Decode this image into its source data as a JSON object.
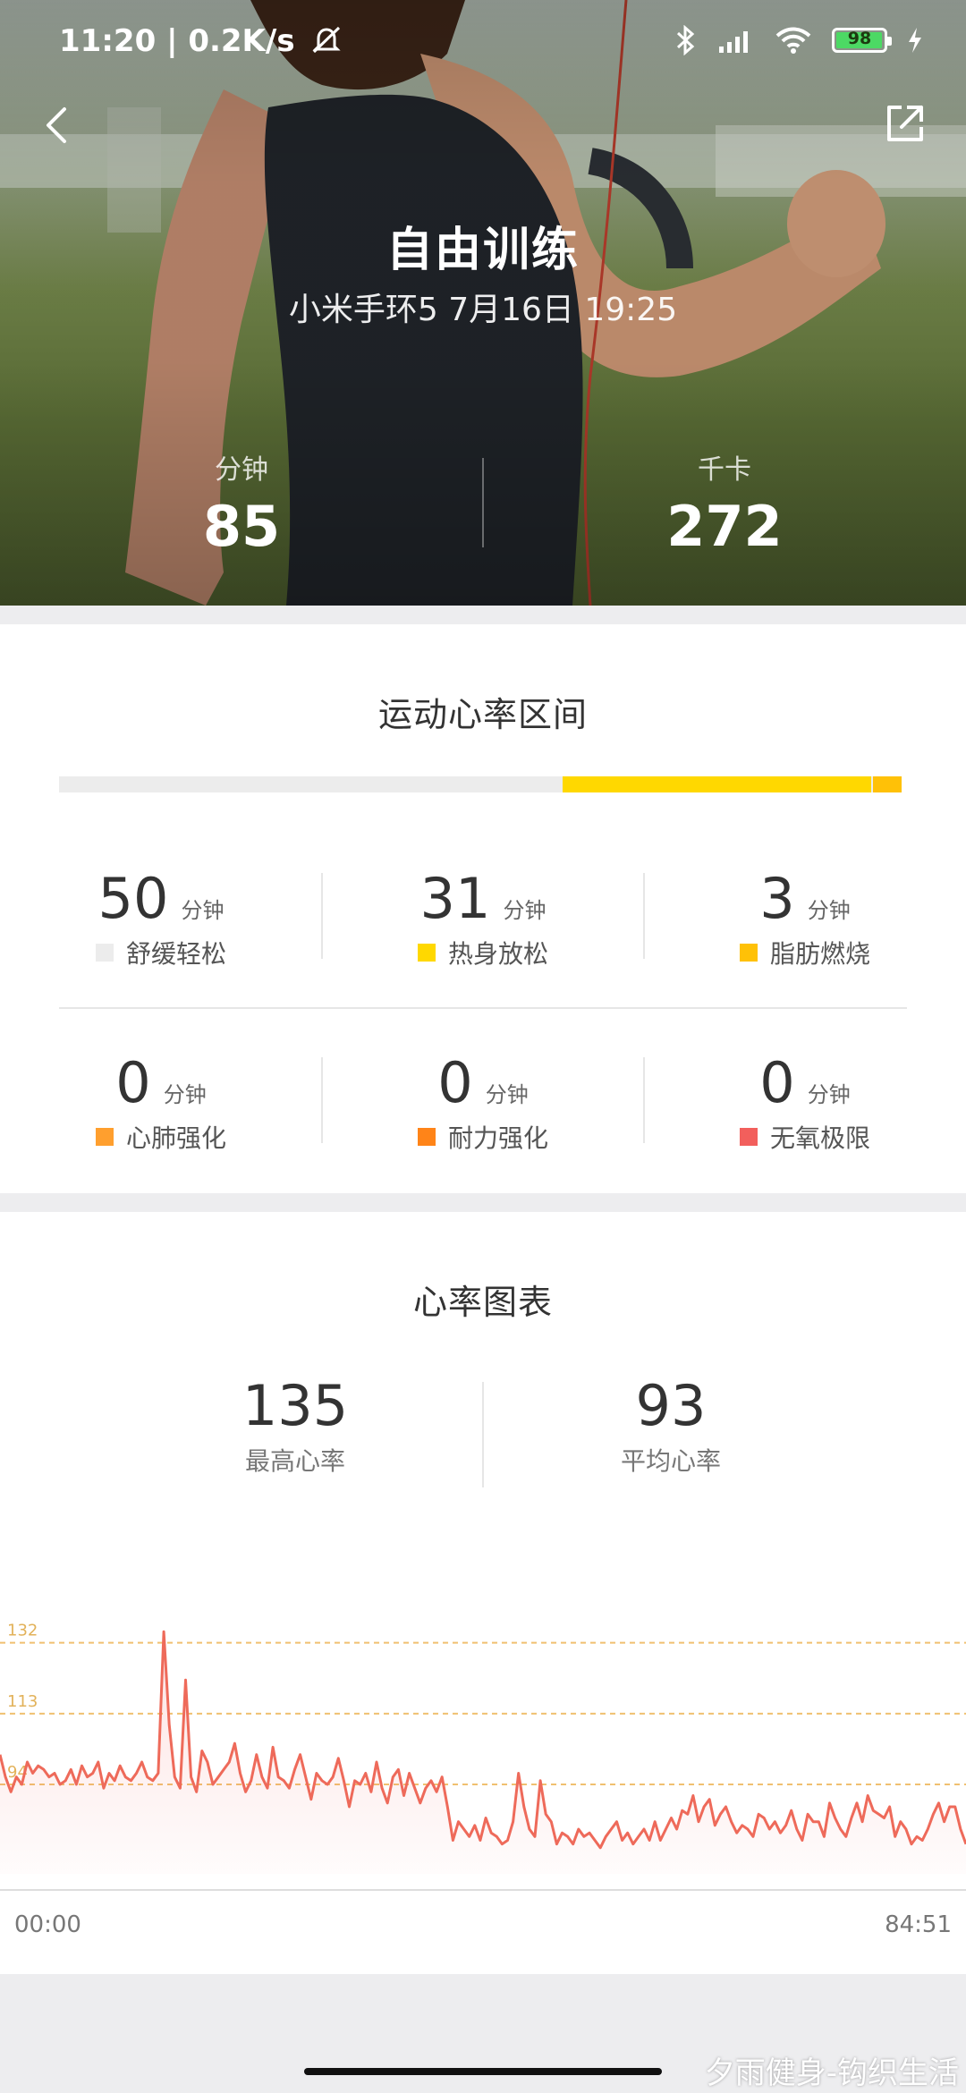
{
  "status_bar": {
    "time_speed": "11:20 | 0.2K/s",
    "battery_level": "98",
    "battery_percent": 98
  },
  "header": {
    "title": "自由训练",
    "subtitle": "小米手环5 7月16日 19:25",
    "stats": [
      {
        "label": "分钟",
        "value": "85"
      },
      {
        "label": "千卡",
        "value": "272"
      }
    ]
  },
  "zones": {
    "title": "运动心率区间",
    "bar_segments": [
      {
        "minutes": 50,
        "color": "#ececec"
      },
      {
        "minutes": 31,
        "color": "#ffd800"
      },
      {
        "minutes": 3,
        "color": "#ffc107"
      }
    ],
    "items": [
      {
        "value": "50",
        "unit": "分钟",
        "name": "舒缓轻松",
        "color": "#ececec"
      },
      {
        "value": "31",
        "unit": "分钟",
        "name": "热身放松",
        "color": "#ffd800"
      },
      {
        "value": "3",
        "unit": "分钟",
        "name": "脂肪燃烧",
        "color": "#ffc107"
      },
      {
        "value": "0",
        "unit": "分钟",
        "name": "心肺强化",
        "color": "#ff9f2e"
      },
      {
        "value": "0",
        "unit": "分钟",
        "name": "耐力强化",
        "color": "#ff8418"
      },
      {
        "value": "0",
        "unit": "分钟",
        "name": "无氧极限",
        "color": "#f25f5c"
      }
    ]
  },
  "heart_chart": {
    "title": "心率图表",
    "max": {
      "value": "135",
      "label": "最高心率"
    },
    "avg": {
      "value": "93",
      "label": "平均心率"
    }
  },
  "chart_data": {
    "type": "area",
    "y_reference_lines": [
      132,
      113,
      94
    ],
    "y_reference_labels": [
      "132",
      "113",
      "94"
    ],
    "x_start_label": "00:00",
    "x_end_label": "84:51",
    "values": [
      102,
      96,
      92,
      96,
      94,
      100,
      97,
      99,
      98,
      96,
      97,
      94,
      95,
      98,
      94,
      99,
      96,
      97,
      100,
      93,
      97,
      95,
      99,
      96,
      95,
      97,
      100,
      96,
      95,
      97,
      135,
      110,
      96,
      93,
      122,
      96,
      92,
      103,
      100,
      94,
      96,
      98,
      100,
      105,
      97,
      92,
      95,
      102,
      96,
      93,
      104,
      96,
      95,
      93,
      98,
      102,
      96,
      90,
      97,
      95,
      94,
      96,
      101,
      95,
      88,
      95,
      94,
      97,
      92,
      100,
      93,
      89,
      96,
      98,
      91,
      97,
      93,
      89,
      93,
      95,
      92,
      96,
      88,
      79,
      84,
      82,
      80,
      83,
      79,
      85,
      81,
      80,
      78,
      79,
      84,
      97,
      88,
      82,
      80,
      95,
      86,
      84,
      78,
      81,
      80,
      78,
      82,
      80,
      81,
      79,
      77,
      80,
      82,
      84,
      79,
      81,
      78,
      80,
      82,
      79,
      84,
      79,
      82,
      85,
      82,
      87,
      86,
      91,
      84,
      88,
      90,
      83,
      86,
      88,
      84,
      81,
      83,
      82,
      80,
      86,
      85,
      82,
      84,
      81,
      83,
      87,
      82,
      79,
      86,
      84,
      84,
      80,
      89,
      85,
      82,
      80,
      85,
      89,
      84,
      91,
      87,
      86,
      85,
      88,
      80,
      84,
      82,
      78,
      80,
      79,
      82,
      86,
      89,
      84,
      88,
      88,
      82,
      78
    ]
  },
  "footer": {
    "watermark": "夕雨健身-钩织生活"
  }
}
